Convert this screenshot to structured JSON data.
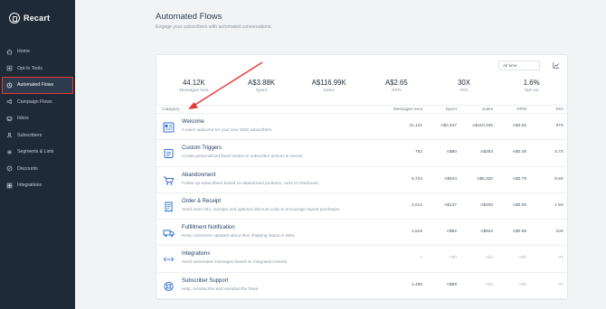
{
  "app": {
    "name": "Recart"
  },
  "sidebar": {
    "items": [
      {
        "label": "Home",
        "icon": "home-icon"
      },
      {
        "label": "Opt-In Tools",
        "icon": "optin-icon"
      },
      {
        "label": "Automated Flows",
        "icon": "flows-icon",
        "active": true
      },
      {
        "label": "Campaign Flows",
        "icon": "campaign-icon"
      },
      {
        "label": "Inbox",
        "icon": "inbox-icon"
      },
      {
        "label": "Subscribers",
        "icon": "subscribers-icon"
      },
      {
        "label": "Segments & Lists",
        "icon": "segments-icon"
      },
      {
        "label": "Discounts",
        "icon": "discounts-icon"
      },
      {
        "label": "Integrations",
        "icon": "integrations-icon"
      }
    ]
  },
  "header": {
    "title": "Automated Flows",
    "subtitle": "Engage your subscribers with automated conversations."
  },
  "filter": {
    "value": "All time"
  },
  "metrics": [
    {
      "value": "44.12K",
      "label": "Messages sent"
    },
    {
      "value": "A$3.88K",
      "label": "Spent"
    },
    {
      "value": "A$116.99K",
      "label": "Sales"
    },
    {
      "value": "A$2.65",
      "label": "RPR"
    },
    {
      "value": "30X",
      "label": "ROI"
    },
    {
      "value": "1.6%",
      "label": "Opt-out"
    }
  ],
  "table": {
    "headers": {
      "category": "Category",
      "messages_sent": "Messages sent",
      "spent": "Spent",
      "sales": "Sales",
      "rpm": "RPM",
      "roi": "ROI"
    },
    "rows": [
      {
        "name": "Welcome",
        "desc": "A warm welcome for your new SMS subscribers.",
        "messages_sent": "31,121",
        "spent": "A$2,947",
        "sales": "A$110,335",
        "rpm": "A$3.55",
        "roi": "37X",
        "icon": "welcome-icon",
        "muted": false
      },
      {
        "name": "Custom Triggers",
        "desc": "Create personalized flows based on subscriber actions & events.",
        "messages_sent": "762",
        "spent": "A$80",
        "sales": "A$293",
        "rpm": "A$0.38",
        "roi": "3.7X",
        "icon": "custom-triggers-icon",
        "muted": false
      },
      {
        "name": "Abandonment",
        "desc": "Follow up subscribers based on abandoned products, carts or checkouts.",
        "messages_sent": "6,724",
        "spent": "A$544",
        "sales": "A$5,320",
        "rpm": "A$0.79",
        "roi": "9.8X",
        "icon": "abandonment-icon",
        "muted": false
      },
      {
        "name": "Order & Receipt",
        "desc": "Send order info, receipts and optional discount code to encourage repeat purchases.",
        "messages_sent": "2,512",
        "spent": "A$137",
        "sales": "A$200",
        "rpm": "A$0.08",
        "roi": "1.5X",
        "icon": "order-receipt-icon",
        "muted": false
      },
      {
        "name": "Fulfillment Notification",
        "desc": "Keep customers updated about their shipping status in SMS.",
        "messages_sent": "1,516",
        "spent": "A$82",
        "sales": "A$842",
        "rpm": "A$0.56",
        "roi": "10X",
        "icon": "fulfillment-icon",
        "muted": false
      },
      {
        "name": "Integrations",
        "desc": "Send automated messages based on integration events.",
        "messages_sent": "0",
        "spent": "A$0",
        "sales": "A$0",
        "rpm": "A$0",
        "roi": "0X",
        "icon": "integrations-row-icon",
        "muted": true
      },
      {
        "name": "Subscriber Support",
        "desc": "Help, resubscribe and unsubscribe flows.",
        "messages_sent": "1,485",
        "spent": "A$89",
        "sales": "A$0",
        "rpm": "A$0",
        "roi": "0X",
        "icon": "support-icon",
        "muted": false
      }
    ]
  },
  "colors": {
    "sidebar_bg": "#1f2a37",
    "accent": "#2f6fd6",
    "highlight": "#e53935",
    "icon_blue": "#2f6fd6"
  }
}
